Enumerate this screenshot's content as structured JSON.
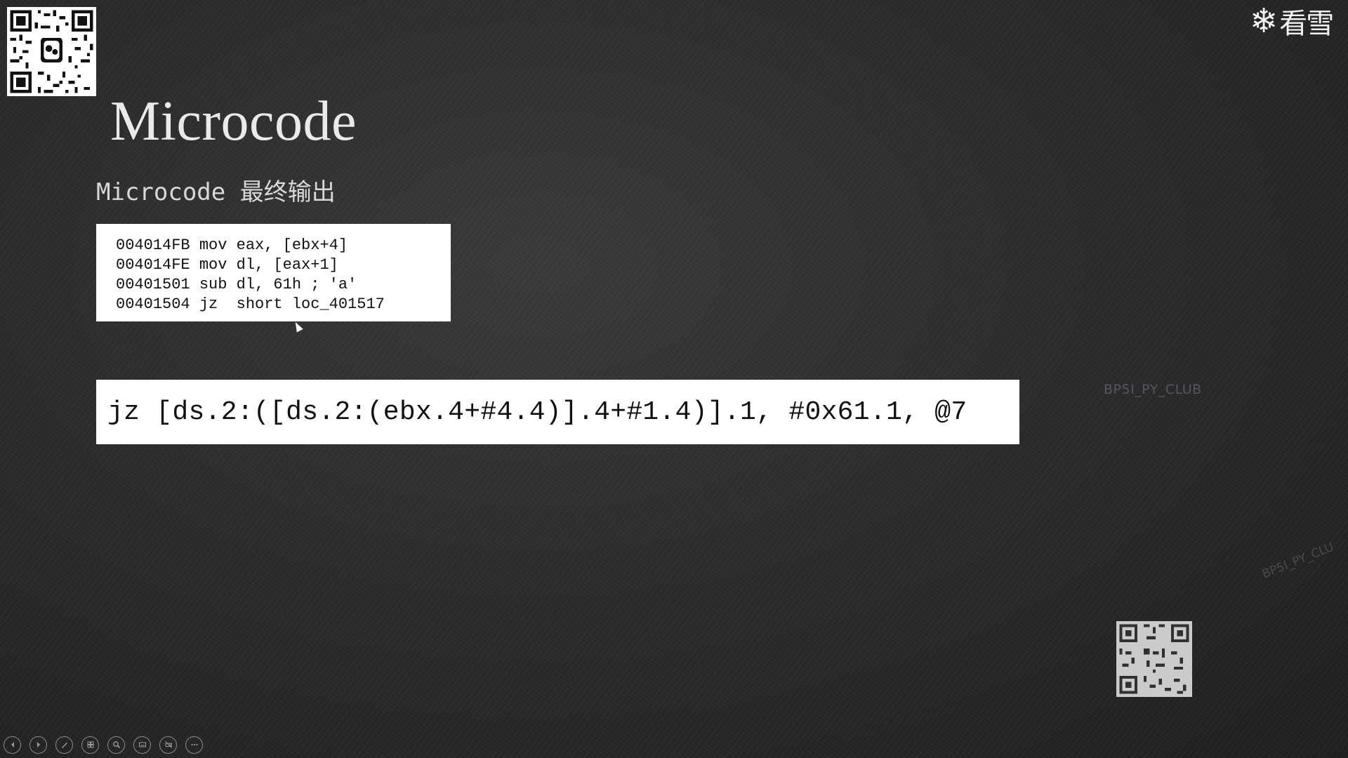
{
  "slide": {
    "title": "Microcode",
    "subtitle": "Microcode 最终输出",
    "asm_code": [
      "004014FB mov eax, [ebx+4]",
      "004014FE mov dl, [eax+1]",
      "00401501 sub dl, 61h ; 'a'",
      "00401504 jz  short loc_401517"
    ],
    "microcode_line": "jz [ds.2:([ds.2:(ebx.4+#4.4)].4+#1.4)].1, #0x61.1, @7",
    "watermark_1": "BP5I_PY_CLUB",
    "watermark_2": "BP5I_PY_CLU"
  },
  "logo": {
    "text": "看雪",
    "icon": "snowflake-icon"
  },
  "qr_codes": [
    "wechat-qr-code",
    "qr-code"
  ],
  "toolbar": {
    "buttons": [
      {
        "name": "previous-slide-button",
        "icon": "chevron-left-icon"
      },
      {
        "name": "next-slide-button",
        "icon": "chevron-right-icon"
      },
      {
        "name": "pen-tool-button",
        "icon": "pen-icon"
      },
      {
        "name": "slide-sorter-button",
        "icon": "grid-icon"
      },
      {
        "name": "zoom-button",
        "icon": "magnifier-icon"
      },
      {
        "name": "subtitles-button",
        "icon": "subtitle-icon"
      },
      {
        "name": "camera-off-button",
        "icon": "camera-off-icon"
      },
      {
        "name": "more-options-button",
        "icon": "ellipsis-icon"
      }
    ]
  },
  "colors": {
    "background": "#2c2c2c",
    "title": "#eaeaea",
    "code_box": "#ffffff",
    "watermark": "#5a5266"
  }
}
